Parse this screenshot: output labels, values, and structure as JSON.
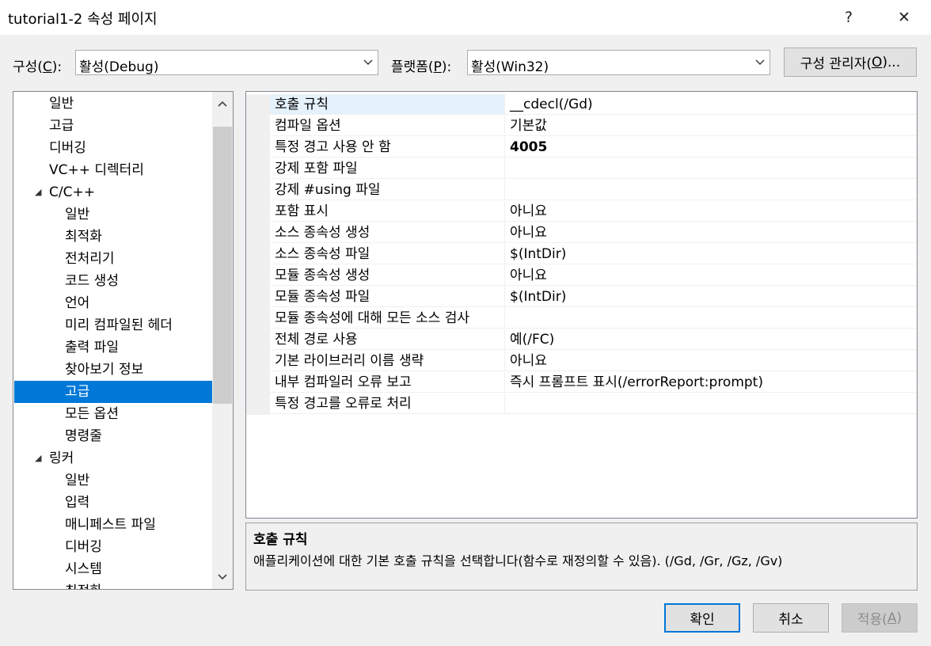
{
  "window": {
    "title": "tutorial1-2 속성 페이지",
    "help_label": "?",
    "close_label": "✕"
  },
  "toolbar": {
    "config_label_pre": "구성(",
    "config_label_key": "C",
    "config_label_post": "):",
    "config_value": "활성(Debug)",
    "platform_label_pre": "플랫폼(",
    "platform_label_key": "P",
    "platform_label_post": "):",
    "platform_value": "활성(Win32)",
    "manager_pre": "구성 관리자(",
    "manager_key": "O",
    "manager_post": ")..."
  },
  "tree": {
    "items": [
      {
        "label": "일반",
        "level": 1
      },
      {
        "label": "고급",
        "level": 1
      },
      {
        "label": "디버깅",
        "level": 1
      },
      {
        "label": "VC++ 디렉터리",
        "level": 1
      },
      {
        "label": "C/C++",
        "level": 1,
        "expanded": true
      },
      {
        "label": "일반",
        "level": 2
      },
      {
        "label": "최적화",
        "level": 2
      },
      {
        "label": "전처리기",
        "level": 2
      },
      {
        "label": "코드 생성",
        "level": 2
      },
      {
        "label": "언어",
        "level": 2
      },
      {
        "label": "미리 컴파일된 헤더",
        "level": 2
      },
      {
        "label": "출력 파일",
        "level": 2
      },
      {
        "label": "찾아보기 정보",
        "level": 2
      },
      {
        "label": "고급",
        "level": 2,
        "selected": true
      },
      {
        "label": "모든 옵션",
        "level": 2
      },
      {
        "label": "명령줄",
        "level": 2
      },
      {
        "label": "링커",
        "level": 1,
        "expanded": true
      },
      {
        "label": "일반",
        "level": 2
      },
      {
        "label": "입력",
        "level": 2
      },
      {
        "label": "매니페스트 파일",
        "level": 2
      },
      {
        "label": "디버깅",
        "level": 2
      },
      {
        "label": "시스템",
        "level": 2
      },
      {
        "label": "최적화",
        "level": 2
      }
    ]
  },
  "properties": [
    {
      "name": "호출 규칙",
      "value": "__cdecl(/Gd)",
      "selected": true
    },
    {
      "name": "컴파일 옵션",
      "value": "기본값"
    },
    {
      "name": "특정 경고 사용 안 함",
      "value": "4005",
      "bold": true
    },
    {
      "name": "강제 포함 파일",
      "value": ""
    },
    {
      "name": "강제 #using 파일",
      "value": ""
    },
    {
      "name": "포함 표시",
      "value": "아니요"
    },
    {
      "name": "소스 종속성 생성",
      "value": "아니요"
    },
    {
      "name": "소스 종속성 파일",
      "value": "$(IntDir)"
    },
    {
      "name": "모듈 종속성 생성",
      "value": "아니요"
    },
    {
      "name": "모듈 종속성 파일",
      "value": "$(IntDir)"
    },
    {
      "name": "모듈 종속성에 대해 모든 소스 검사",
      "value": ""
    },
    {
      "name": "전체 경로 사용",
      "value": "예(/FC)"
    },
    {
      "name": "기본 라이브러리 이름 생략",
      "value": "아니요"
    },
    {
      "name": "내부 컴파일러 오류 보고",
      "value": "즉시 프롬프트 표시(/errorReport:prompt)"
    },
    {
      "name": "특정 경고를 오류로 처리",
      "value": ""
    }
  ],
  "description": {
    "title": "호출 규칙",
    "text": "애플리케이션에 대한 기본 호출 규칙을 선택합니다(함수로 재정의할 수 있음).     (/Gd, /Gr, /Gz, /Gv)"
  },
  "buttons": {
    "ok": "확인",
    "cancel": "취소",
    "apply_pre": "적용(",
    "apply_key": "A",
    "apply_post": ")"
  },
  "icons": {
    "collapse": "triangle-expanded-icon",
    "dropdown": "chevron-down-icon",
    "scroll_up": "chevron-up-icon",
    "scroll_down": "chevron-down-icon"
  },
  "colors": {
    "accent": "#0078d7",
    "window_bg": "#f0f0f0"
  }
}
